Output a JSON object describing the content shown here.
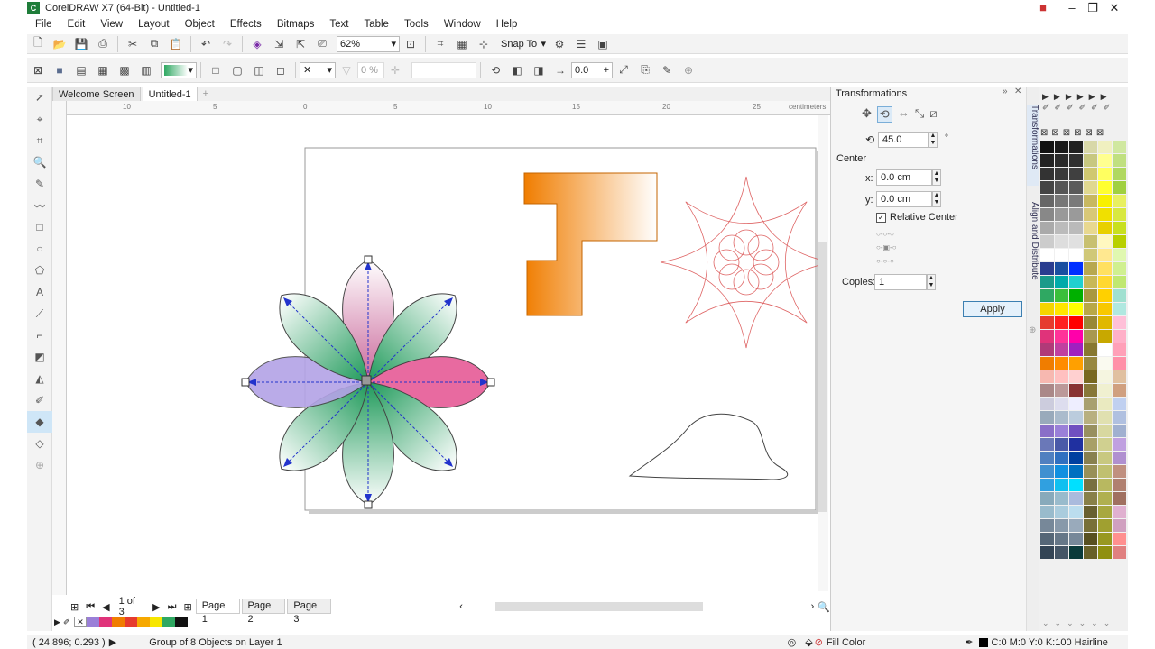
{
  "window": {
    "title": "CorelDRAW X7 (64-Bit) - Untitled-1",
    "logo": "corel-logo-icon"
  },
  "menu": [
    "File",
    "Edit",
    "View",
    "Layout",
    "Object",
    "Effects",
    "Bitmaps",
    "Text",
    "Table",
    "Tools",
    "Window",
    "Help"
  ],
  "toolbar_standard": {
    "zoom": "62%",
    "snap_to": "Snap To"
  },
  "toolbar_property": {
    "transparency_value": "0 %",
    "angle_value": "0.0"
  },
  "tabs": {
    "welcome": "Welcome Screen",
    "doc": "Untitled-1"
  },
  "ruler": {
    "unit": "centimeters",
    "h_ticks": [
      "10",
      "5",
      "0",
      "5",
      "10",
      "15",
      "20",
      "25"
    ]
  },
  "page_nav": {
    "counter": "1 of 3",
    "pages": [
      "Page 1",
      "Page 2",
      "Page 3"
    ]
  },
  "status": {
    "coords": "( 24.896; 0.293 )",
    "object_info": "Group of 8 Objects on Layer 1",
    "fill": "Fill Color",
    "outline": "C:0 M:0 Y:0 K:100  Hairline"
  },
  "docker": {
    "title": "Transformations",
    "rotation": "45.0",
    "degree_unit": "°",
    "center_label": "Center",
    "x_label": "x:",
    "x_value": "0.0 cm",
    "y_label": "y:",
    "y_value": "0.0 cm",
    "relative_center": "Relative Center",
    "copies_label": "Copies:",
    "copies_value": "1",
    "apply": "Apply",
    "side_tabs": [
      "Transformations",
      "Align and Distribute"
    ]
  },
  "colors": {
    "accent": "#0078d7",
    "orange": "#f07d00",
    "flower_green": "#2fa862",
    "flower_pink": "#e0337a",
    "flower_purple": "#9a7fd8"
  }
}
